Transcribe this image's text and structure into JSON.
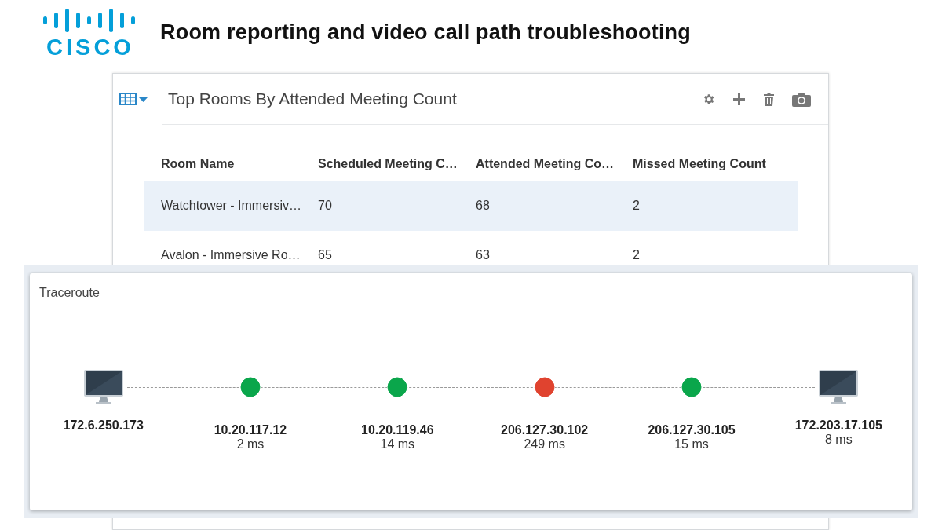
{
  "header": {
    "logo_text": "CISCO",
    "title": "Room reporting and video call path troubleshooting"
  },
  "report": {
    "title": "Top Rooms By Attended Meeting Count",
    "columns": [
      "Room Name",
      "Scheduled Meeting C…",
      "Attended Meeting Co…",
      "Missed Meeting Count"
    ],
    "rows": [
      {
        "selected": true,
        "cells": [
          "Watchtower - Immersiv…",
          "70",
          "68",
          "2"
        ]
      },
      {
        "selected": false,
        "cells": [
          "Avalon - Immersive Ro…",
          "65",
          "63",
          "2"
        ]
      }
    ]
  },
  "traceroute": {
    "title": "Traceroute",
    "hops": [
      {
        "kind": "host",
        "address": "172.6.250.173"
      },
      {
        "kind": "router",
        "address": "10.20.117.12",
        "latency": "2 ms",
        "color": "#0aa64b"
      },
      {
        "kind": "router",
        "address": "10.20.119.46",
        "latency": "14 ms",
        "color": "#0aa64b"
      },
      {
        "kind": "router",
        "address": "206.127.30.102",
        "latency": "249 ms",
        "color": "#e0432f"
      },
      {
        "kind": "router",
        "address": "206.127.30.105",
        "latency": "15 ms",
        "color": "#0aa64b"
      },
      {
        "kind": "host",
        "address": "172.203.17.105",
        "latency": "8 ms"
      }
    ]
  }
}
